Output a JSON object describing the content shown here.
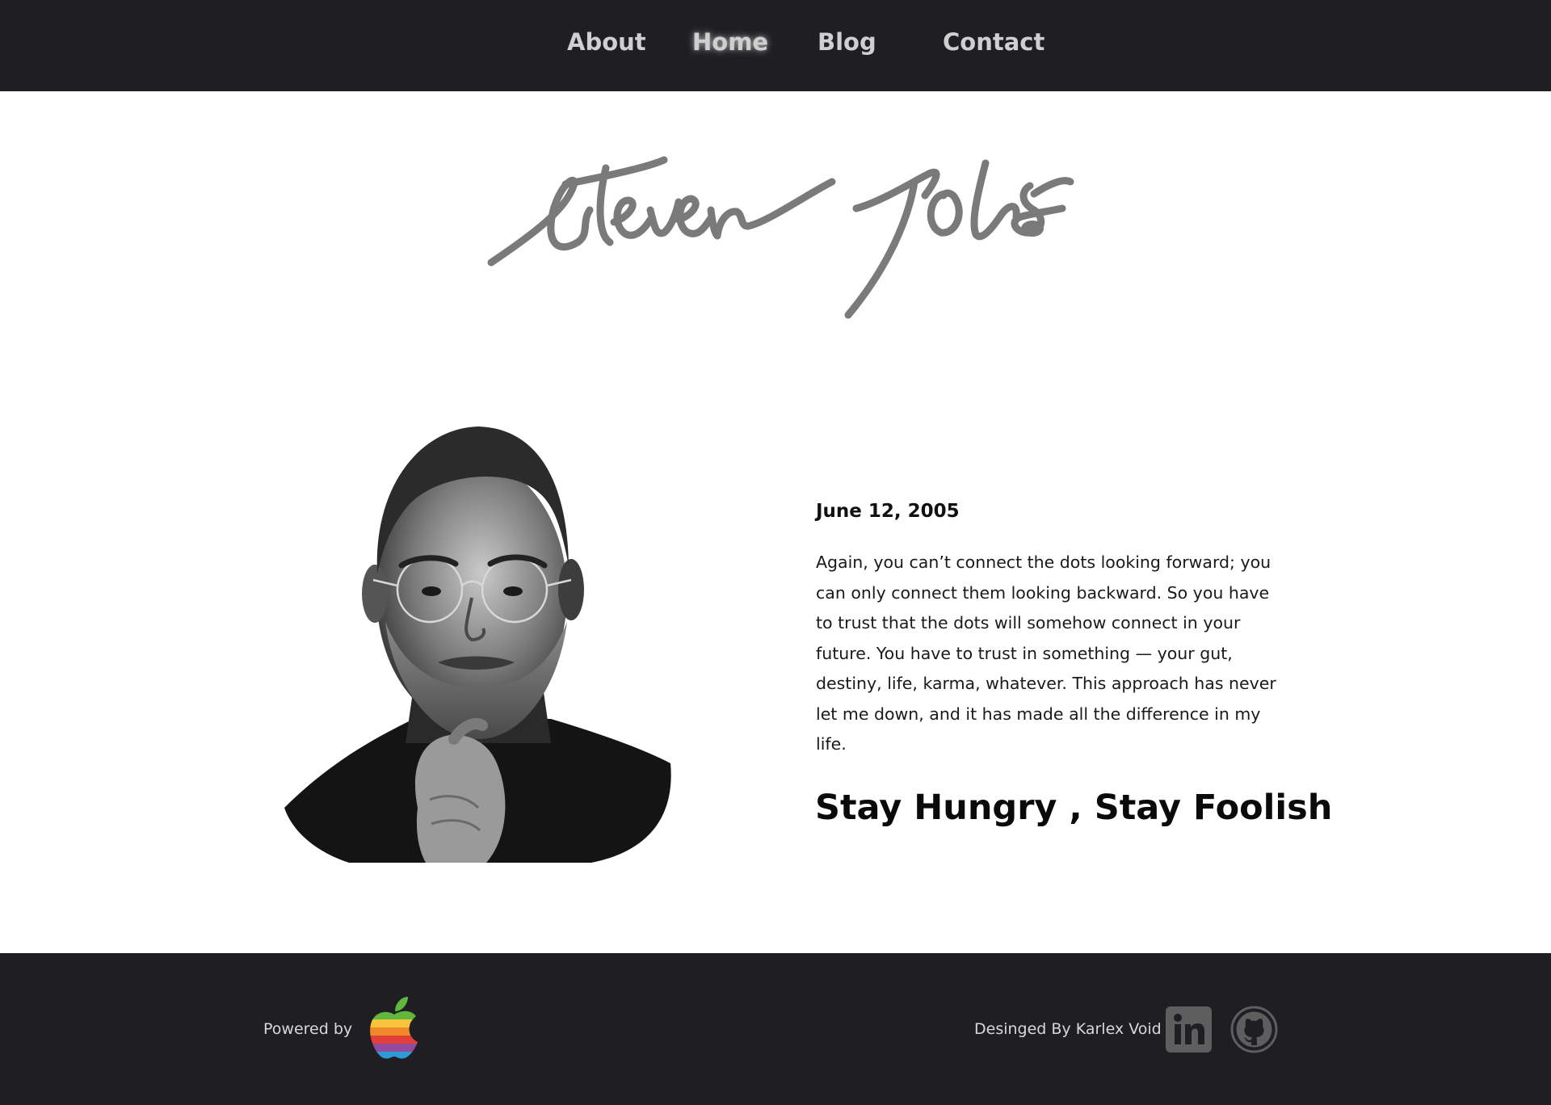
{
  "nav": {
    "items": [
      {
        "label": "About"
      },
      {
        "label": "Home"
      },
      {
        "label": "Blog"
      },
      {
        "label": "Contact"
      }
    ]
  },
  "hero": {
    "signature_text": "steven jobs"
  },
  "speech": {
    "date": "June 12, 2005",
    "quote": "Again, you can’t connect the dots looking forward; you can only connect them looking backward. So you have to trust that the dots will somehow connect in your future. You have to trust in something — your gut, destiny, life, karma, whatever. This approach has never let me down, and it has made all the difference in my life.",
    "motto": "Stay Hungry , Stay Foolish"
  },
  "footer": {
    "powered_label": "Powered by",
    "designer_label": "Desinged By Karlex Void"
  },
  "colors": {
    "nav_bg": "#1f1f23",
    "nav_text": "#cfcfcf",
    "signature": "#7a7a7a",
    "footer_bg": "#1f1f23",
    "social_icon": "#5e5e5e"
  },
  "icons": {
    "brand": "apple-rainbow-logo",
    "social": [
      "linkedin-icon",
      "github-icon"
    ]
  }
}
